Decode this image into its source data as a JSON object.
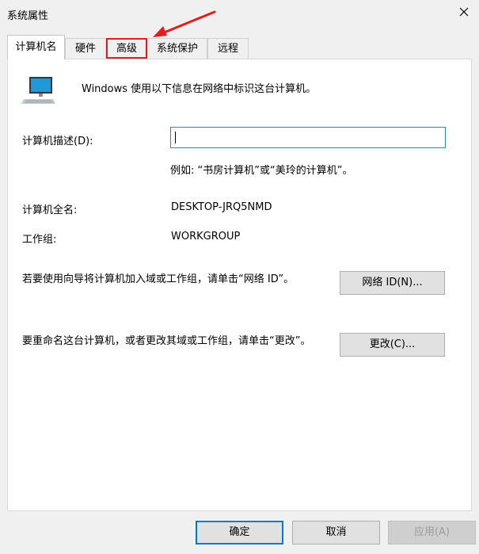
{
  "window": {
    "title": "系统属性"
  },
  "tabs": [
    {
      "label": "计算机名"
    },
    {
      "label": "硬件"
    },
    {
      "label": "高级"
    },
    {
      "label": "系统保护"
    },
    {
      "label": "远程"
    }
  ],
  "header": {
    "text": "Windows 使用以下信息在网络中标识这台计算机。"
  },
  "form": {
    "description_label": "计算机描述(D):",
    "description_value": "",
    "description_hint": "例如: “书房计算机”或“美玲的计算机”。",
    "fullname_label": "计算机全名:",
    "fullname_value": "DESKTOP-JRQ5NMD",
    "workgroup_label": "工作组:",
    "workgroup_value": "WORKGROUP"
  },
  "actions": {
    "network_text": "若要使用向导将计算机加入域或工作组，请单击“网络 ID”。",
    "network_button": "网络 ID(N)...",
    "rename_text": "要重命名这台计算机，或者更改其域或工作组，请单击“更改”。",
    "rename_button": "更改(C)..."
  },
  "footer": {
    "ok": "确定",
    "cancel": "取消",
    "apply": "应用(A)"
  },
  "colors": {
    "highlight": "#e01e1e",
    "accent": "#0078d7",
    "input_border": "#2e8aa6"
  }
}
